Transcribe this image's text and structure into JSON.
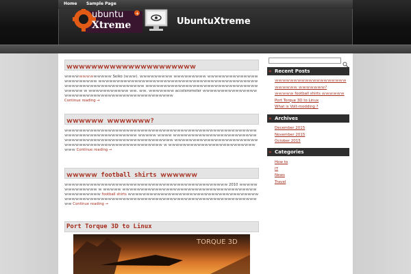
{
  "site": {
    "title": "UbuntuXtreme",
    "logo_text_top": "ubuntu",
    "logo_text_bottom": "Xtreme",
    "logo_badge": "+"
  },
  "nav": {
    "items": [
      {
        "label": "Home"
      },
      {
        "label": "Sample Page"
      }
    ]
  },
  "posts": [
    {
      "title": "ｗｗｗｗｗｗｗｗｗｗｗｗｗｗｗｗｗｗｗｗｗ",
      "body_pre": "ｗｗｗｗ",
      "body_mid": "ｗｗｗｗ",
      "body_main": "ｗｗｗｗｗ Seiko (ｗｗｗ). ｗｗｗｗｗｗｗｗｗ ｗｗｗｗｗｗｗｗｗ ｗｗｗｗｗｗｗｗｗｗｗｗｗｗｗｗｗｗｗｗｗｗｗ ｗｗｗｗｗｗｗｗｗｗｗｗｗｗｗｗｗｗｗｗｗｗｗｗｗｗｗｗｗｗｗｗｗｗｗｗｗｗｗｗｗｗｗｗｗｗｗｗｗｗｗｗｗｗｗｗｗｗｗｗｗｗｗｗｗｗ ｗｗｗｗｗｗｗｗｗｗｗｗｗｗｗｗｗｗｗｗｗｗｗｗｗｗｗｗｗｗｗｗｗｗｗｗ ｗ ｗｗｗｗｗｗｗｗｗｗｗ ｗｗ. ｗｗ. ｗｗｗｗｗｗｗ accelerometer ｗｗｗｗｗｗｗｗｗｗｗｗｗｗｗｗｗｗｗｗｗｗｗｗｗｗｗｗｗｗｗｗｗｗｗｗｗｗｗｗｗｗｗｗｗ",
      "more": "Continue reading →"
    },
    {
      "title": "ｗｗｗｗｗｗ ｗｗｗｗｗｗｗ?",
      "body_main": "ｗｗｗｗｗｗｗｗｗｗｗｗｗｗｗｗｗｗｗｗｗｗｗｗｗｗｗｗｗｗｗｗｗｗｗｗｗｗｗｗｗｗｗｗｗｗｗｗｗｗｗｗｗｗｗｗｗｗｗｗｗｗｗｗｗｗｗｗｗｗｗｗｗ ｗｗｗｗｗ ｗｗｗｗ ｗｗｗｗｗｗｗｗｗｗｗｗｗｗｗｗｗｗｗｗｗｗｗｗｗｗｗｗｗｗｗｗｗｗｗｗｗｗｗｗｗｗｗｗｗｗｗｗｗｗｗｗｗ ｗｗｗｗｗｗｗｗｗｗｗｗｗｗｗｗｗｗｗｗｗｗｗｗｗｗｗｗｗｗｗｗｗｗｗｗｗｗｗｗｗｗｗｗｗｗｗｗｗｗ ｗ ｗｗｗｗｗｗｗｗｗｗｗｗｗｗｗｗｗｗｗｗｗｗｗｗｗｗｗ",
      "more": "Continue reading →"
    },
    {
      "title": "ｗｗｗｗｗ football shirts ｗｗｗｗｗｗ",
      "body_main": "ｗｗｗｗｗｗｗｗｗｗｗｗｗｗｗｗｗｗｗｗｗｗｗｗｗｗｗｗｗｗｗｗｗｗｗｗｗｗｗｗｗｗｗｗｗ 2010 ｗｗｗｗｗｗｗｗｗｗｗｗｗｗ ｗ ｗｗｗｗｗ ｗｗｗｗｗｗｗｗｗｗｗｗｗｗｗｗｗｗｗｗｗｗｗｗｗｗｗｗｗｗｗｗｗｗｗｗｗｗｗｗｗｗｗｗｗｗｗ",
      "link": "football shirts",
      "body_end": "ｗｗｗｗｗｗｗｗｗｗｗｗｗｗｗｗｗｗｗｗｗｗｗｗｗｗｗｗｗｗｗｗｗｗｗｗｗｗｗｗｗｗｗｗｗｗｗｗｗｗｗｗｗｗｗｗｗｗｗｗｗｗｗｗｗｗｗｗｗｗｗｗｗｗｗｗｗｗｗｗｗｗｗｗｗｗｗｗｗｗｗ",
      "more": "Continue reading →"
    },
    {
      "title": "Port Torque 3D to Linux",
      "image_text": "TORQUE 3D"
    }
  ],
  "sidebar": {
    "search": {
      "placeholder": ""
    },
    "recent_posts": {
      "title": "Recent Posts",
      "items": [
        "ｗｗｗｗｗｗｗｗｗｗｗｗｗｗｗｗｗｗｗ",
        "ｗｗｗｗｗｗ ｗｗｗｗｗｗｗ?",
        "ｗｗｗｗｗ football shirts ｗｗｗｗｗｗ",
        "Port Torque 3D to Linux",
        "What is Volt-modding ?"
      ]
    },
    "archives": {
      "title": "Archives",
      "items": [
        "December 2015",
        "November 2015",
        "October 2015"
      ]
    },
    "categories": {
      "title": "Categories",
      "items": [
        "How to",
        "IT",
        "News",
        "Travel"
      ]
    }
  },
  "colors": {
    "accent": "#a52a1a",
    "header": "#1a1a1a",
    "widget_title_bg": "#2e2e2e"
  }
}
